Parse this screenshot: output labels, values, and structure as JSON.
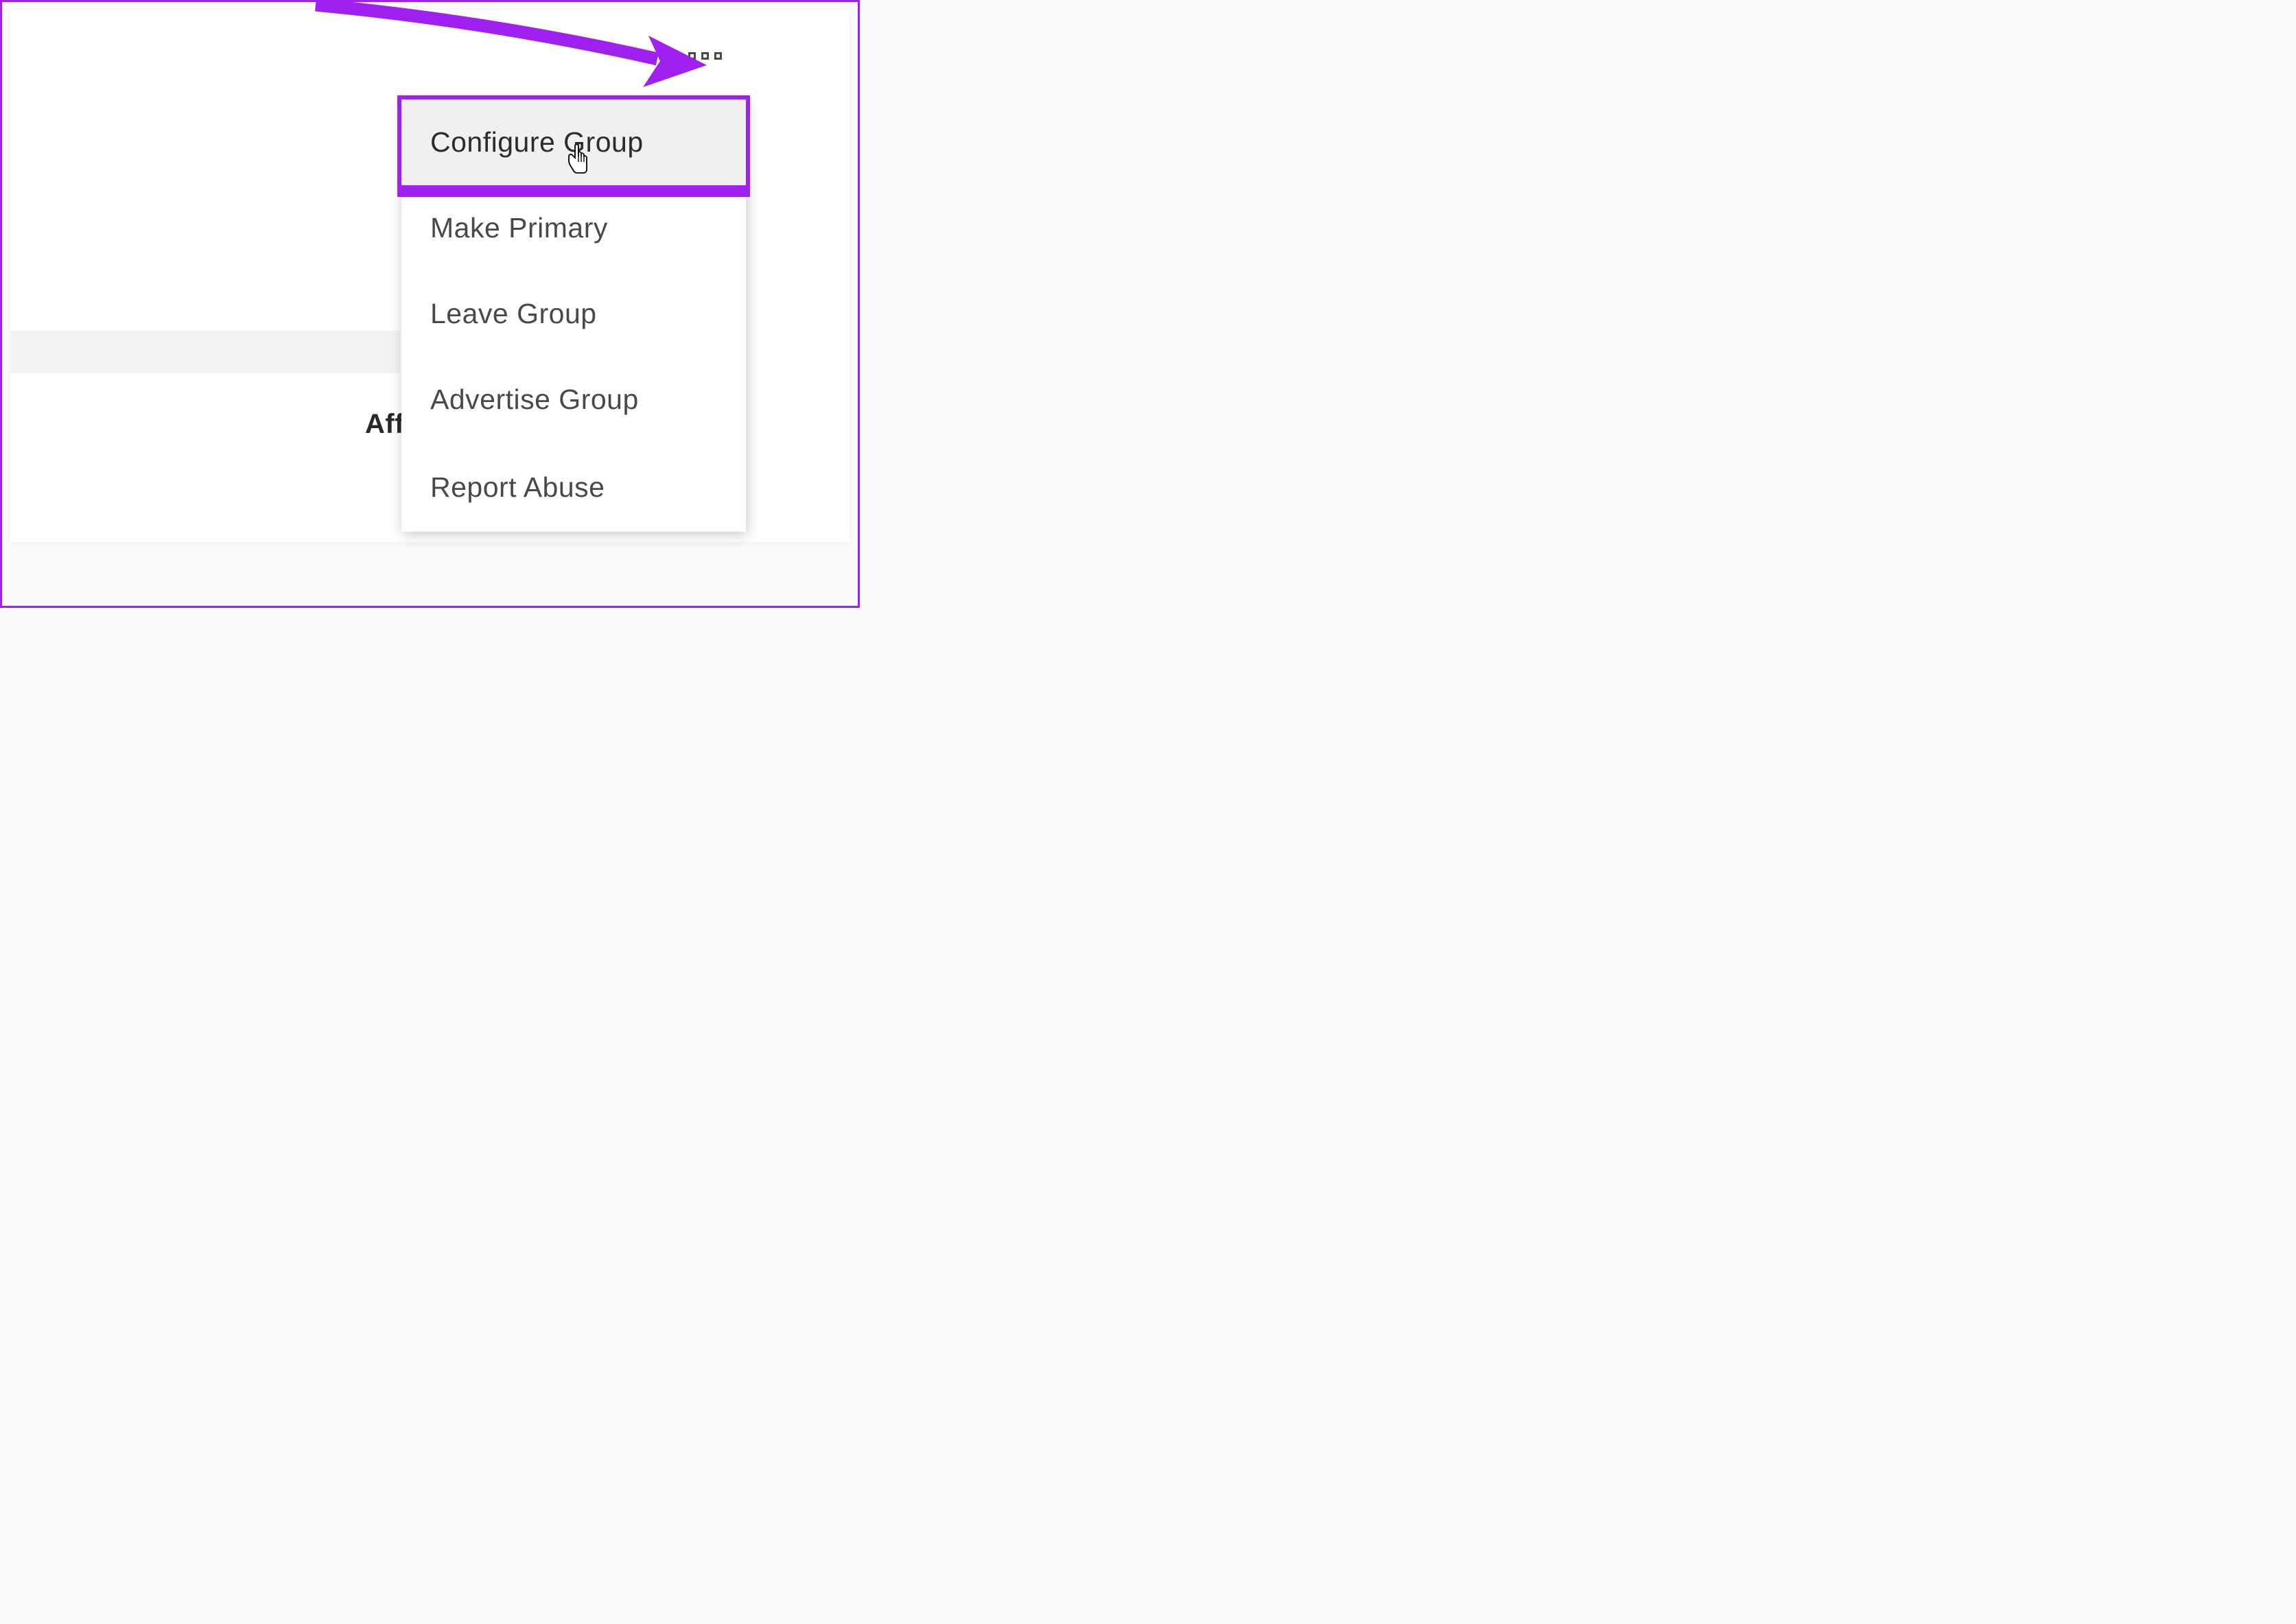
{
  "tabs": {
    "partial_label": "Affi"
  },
  "dropdown": {
    "items": [
      {
        "label": "Configure Group",
        "hovered": true
      },
      {
        "label": "Make Primary",
        "hovered": false
      },
      {
        "label": "Leave Group",
        "hovered": false
      },
      {
        "label": "Advertise Group",
        "hovered": false
      },
      {
        "label": "Report Abuse",
        "hovered": false
      }
    ]
  },
  "annotation": {
    "highlight_color": "#a020f0",
    "arrow_color": "#a020f0"
  }
}
